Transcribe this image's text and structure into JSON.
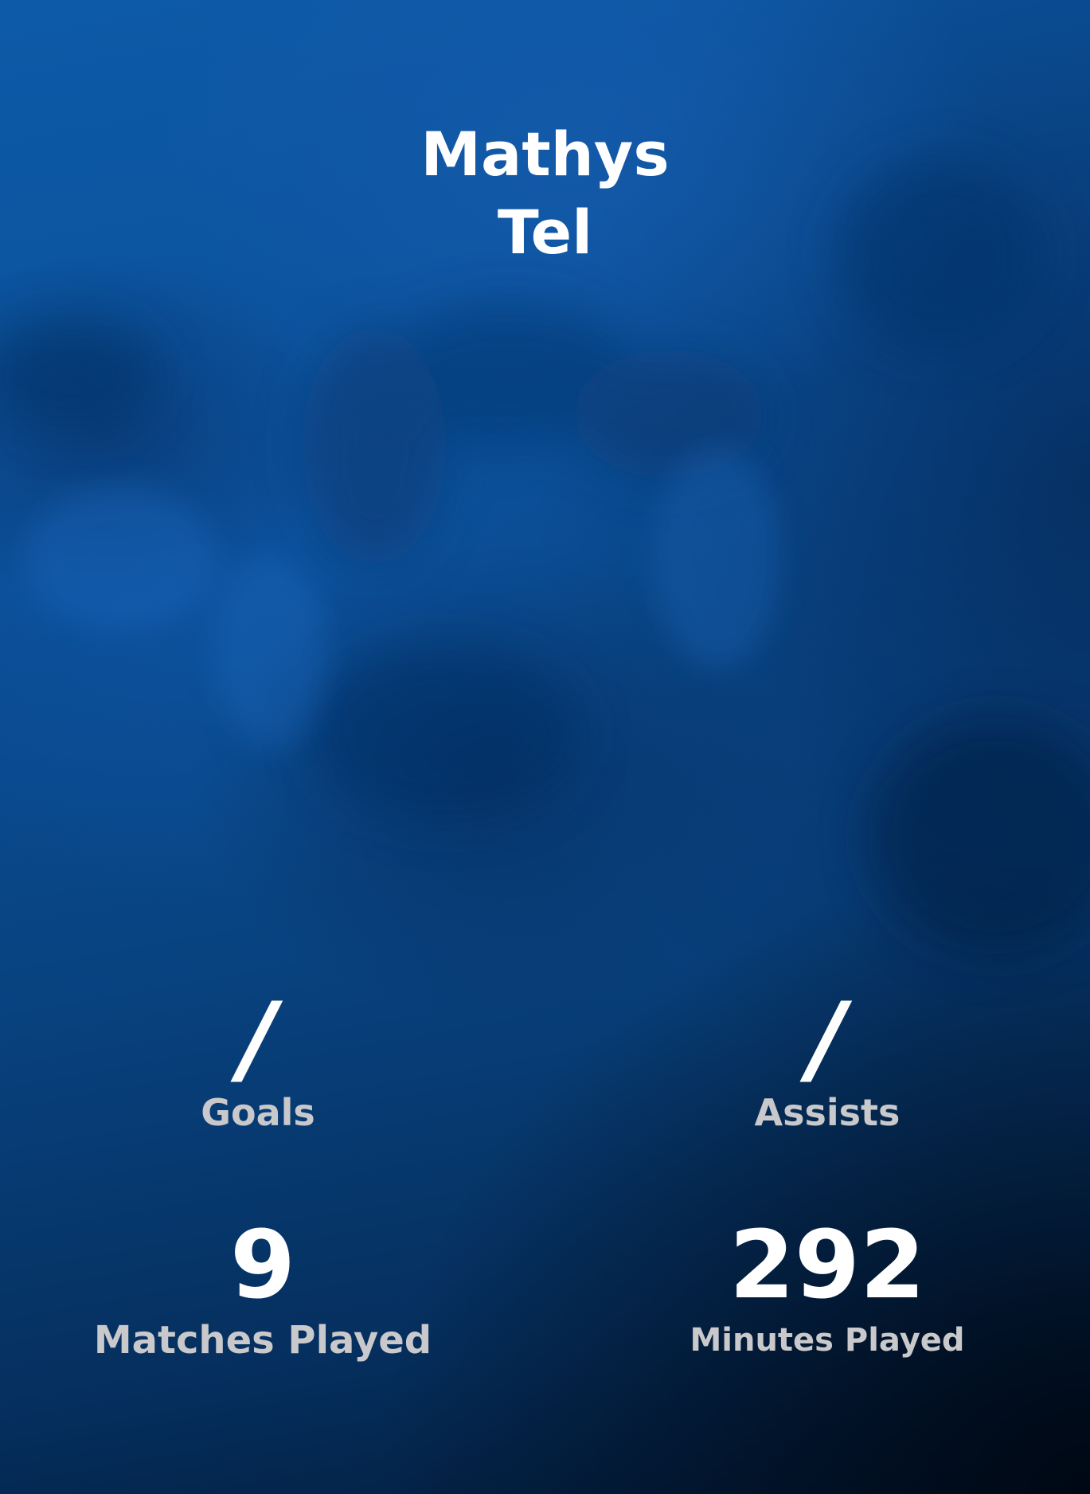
{
  "player": {
    "first_name": "Mathys",
    "last_name": "Tel"
  },
  "stats": {
    "goals": {
      "value": "/",
      "label": "Goals"
    },
    "assists": {
      "value": "/",
      "label": "Assists"
    },
    "matches": {
      "value": "9",
      "label": "Matches Played"
    },
    "minutes": {
      "value": "292",
      "label": "Minutes Played"
    }
  },
  "colors": {
    "background": "#0a4a8f",
    "background_dark": "#021a38",
    "value_text": "#ffffff",
    "label_text": "#c9c9cc"
  }
}
